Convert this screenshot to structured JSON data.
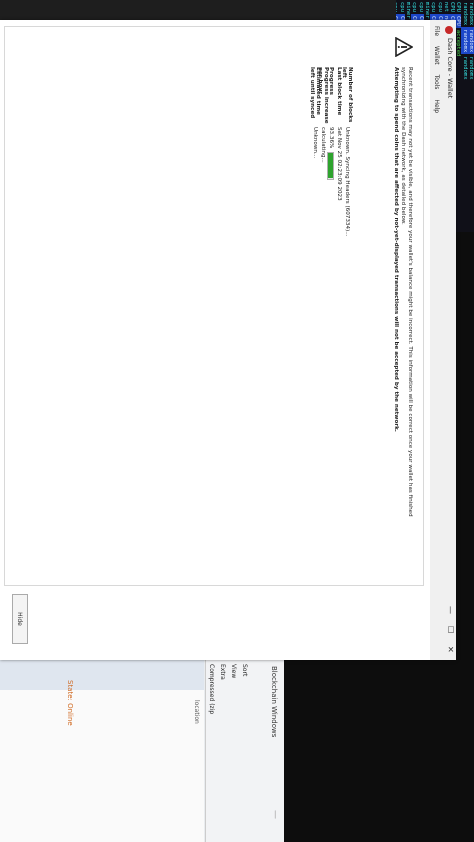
{
  "window": {
    "title": "Dash Core - Wallet",
    "minimize": "—",
    "maximize": "☐",
    "close": "✕"
  },
  "menu": {
    "file": "File",
    "wallet": "Wallet",
    "tools": "Tools",
    "help": "Help"
  },
  "warning": {
    "line1": "Recent transactions may not yet be visible, and therefore your wallet's balance might be incorrect. This information will be correct once your wallet has finished synchronizing with",
    "line2": "the Dash network, as detailed below.",
    "line3": "Attempting to spend coins that are affected by not-yet-displayed transactions will not be accepted by the network."
  },
  "sync": {
    "blocks_left_label": "Number of blocks left",
    "blocks_left_value": "Unknown. Syncing Headers (607334)...",
    "last_block_label": "Last block time",
    "last_block_value": "Sat Nov 25 02:23:09 2023",
    "progress_label": "Progress",
    "progress_value": "93.36%",
    "progress_fraction": 0.9336,
    "increase_label": "Progress increase per hour",
    "increase_value": "calculating...",
    "eta_label": "Estimated time left until synced",
    "eta_value": "Unknown..."
  },
  "hide_button": "Hide",
  "terminal": {
    "rows": [
      [
        "randomx",
        "randomx",
        "randomx"
      ],
      [
        "randomx",
        "randomx",
        "randomx"
      ],
      [
        "CPU",
        "CPU",
        "accepted"
      ],
      [
        "CPU",
        "CPU",
        "net"
      ],
      [
        "net",
        "new job",
        "new job"
      ],
      [
        "cpu",
        "CPU",
        "accepted"
      ],
      [
        "cpu",
        "CPU",
        "accepted"
      ],
      [
        "miner",
        "miner",
        "speed"
      ],
      [
        "cpu",
        "CPU",
        "accepted"
      ],
      [
        "cpu",
        "CPU",
        "accepted"
      ],
      [
        "miner",
        "miner",
        "speed"
      ],
      [
        "cpu",
        "CPU",
        "accepted"
      ],
      [
        "cpu",
        "CPU",
        "accepted"
      ],
      [
        "miner",
        "miner",
        "speed"
      ],
      [
        "cpu",
        "CPU",
        "accepted"
      ],
      [
        "cpu",
        "CPU",
        "accepted"
      ],
      [
        "miner",
        "miner",
        "speed"
      ],
      [
        "cpu",
        "CPU",
        "accepted"
      ],
      [
        "miner",
        "miner",
        "speed"
      ],
      [
        "cpu",
        "CPU",
        "accepted"
      ],
      [
        "miner",
        "miner",
        "speed"
      ],
      [
        "cpu",
        "CPU",
        "accepted"
      ]
    ]
  },
  "explorer": {
    "title": "Blockchain Windows",
    "sort": "Sort",
    "view": "View",
    "extract": "Extra",
    "compressed": "Compressed (zip",
    "location": "location",
    "state": "State: Online",
    "ctrl_min": "—",
    "ctrl_close": "✕"
  }
}
